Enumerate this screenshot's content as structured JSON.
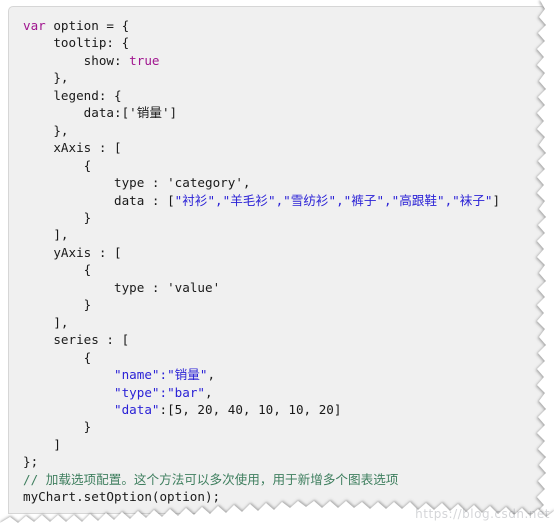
{
  "editor": {
    "language": "javascript",
    "background_color": "#f0f0f0",
    "border_color": "#d6d6d6",
    "colors": {
      "keyword": "#a0158f",
      "boolean": "#a0158f",
      "double_quoted_string": "#2b22d6",
      "single_quoted_string": "#1a1a1a",
      "comment": "#3f7f5f",
      "plain_text": "#1a1a1a"
    },
    "lines": [
      {
        "indent": 0,
        "tokens": [
          {
            "t": "var",
            "c": "kw"
          },
          {
            "t": " option = {",
            "c": "plain"
          }
        ]
      },
      {
        "indent": 1,
        "tokens": [
          {
            "t": "tooltip: {",
            "c": "plain"
          }
        ]
      },
      {
        "indent": 2,
        "tokens": [
          {
            "t": "show: ",
            "c": "plain"
          },
          {
            "t": "true",
            "c": "bool"
          }
        ]
      },
      {
        "indent": 1,
        "tokens": [
          {
            "t": "},",
            "c": "plain"
          }
        ]
      },
      {
        "indent": 1,
        "tokens": [
          {
            "t": "legend: {",
            "c": "plain"
          }
        ]
      },
      {
        "indent": 2,
        "tokens": [
          {
            "t": "data:['",
            "c": "plain"
          },
          {
            "t": "销量",
            "c": "str cjk"
          },
          {
            "t": "']",
            "c": "plain"
          }
        ]
      },
      {
        "indent": 1,
        "tokens": [
          {
            "t": "},",
            "c": "plain"
          }
        ]
      },
      {
        "indent": 1,
        "tokens": [
          {
            "t": "xAxis : [",
            "c": "plain"
          }
        ]
      },
      {
        "indent": 2,
        "tokens": [
          {
            "t": "{",
            "c": "plain"
          }
        ]
      },
      {
        "indent": 3,
        "tokens": [
          {
            "t": "type : 'category',",
            "c": "plain"
          }
        ]
      },
      {
        "indent": 3,
        "tokens": [
          {
            "t": "data : [",
            "c": "plain"
          },
          {
            "t": "\"",
            "c": "dstr"
          },
          {
            "t": "衬衫",
            "c": "dstr cjk"
          },
          {
            "t": "\",\"",
            "c": "dstr"
          },
          {
            "t": "羊毛衫",
            "c": "dstr cjk"
          },
          {
            "t": "\",\"",
            "c": "dstr"
          },
          {
            "t": "雪纺衫",
            "c": "dstr cjk"
          },
          {
            "t": "\",\"",
            "c": "dstr"
          },
          {
            "t": "裤子",
            "c": "dstr cjk"
          },
          {
            "t": "\",\"",
            "c": "dstr"
          },
          {
            "t": "高跟鞋",
            "c": "dstr cjk"
          },
          {
            "t": "\",\"",
            "c": "dstr"
          },
          {
            "t": "袜子",
            "c": "dstr cjk"
          },
          {
            "t": "\"",
            "c": "dstr"
          },
          {
            "t": "]",
            "c": "plain"
          }
        ]
      },
      {
        "indent": 2,
        "tokens": [
          {
            "t": "}",
            "c": "plain"
          }
        ]
      },
      {
        "indent": 1,
        "tokens": [
          {
            "t": "],",
            "c": "plain"
          }
        ]
      },
      {
        "indent": 1,
        "tokens": [
          {
            "t": "yAxis : [",
            "c": "plain"
          }
        ]
      },
      {
        "indent": 2,
        "tokens": [
          {
            "t": "{",
            "c": "plain"
          }
        ]
      },
      {
        "indent": 3,
        "tokens": [
          {
            "t": "type : 'value'",
            "c": "plain"
          }
        ]
      },
      {
        "indent": 2,
        "tokens": [
          {
            "t": "}",
            "c": "plain"
          }
        ]
      },
      {
        "indent": 1,
        "tokens": [
          {
            "t": "],",
            "c": "plain"
          }
        ]
      },
      {
        "indent": 1,
        "tokens": [
          {
            "t": "series : [",
            "c": "plain"
          }
        ]
      },
      {
        "indent": 2,
        "tokens": [
          {
            "t": "{",
            "c": "plain"
          }
        ]
      },
      {
        "indent": 3,
        "tokens": [
          {
            "t": "\"name\":\"",
            "c": "dstr"
          },
          {
            "t": "销量",
            "c": "dstr cjk"
          },
          {
            "t": "\"",
            "c": "dstr"
          },
          {
            "t": ",",
            "c": "plain"
          }
        ]
      },
      {
        "indent": 3,
        "tokens": [
          {
            "t": "\"type\":\"bar\"",
            "c": "dstr"
          },
          {
            "t": ",",
            "c": "plain"
          }
        ]
      },
      {
        "indent": 3,
        "tokens": [
          {
            "t": "\"data\"",
            "c": "dstr"
          },
          {
            "t": ":[5, 20, 40, 10, 10, 20]",
            "c": "plain"
          }
        ]
      },
      {
        "indent": 2,
        "tokens": [
          {
            "t": "}",
            "c": "plain"
          }
        ]
      },
      {
        "indent": 1,
        "tokens": [
          {
            "t": "]",
            "c": "plain"
          }
        ]
      },
      {
        "indent": 0,
        "tokens": [
          {
            "t": "};",
            "c": "plain"
          }
        ]
      },
      {
        "indent": 0,
        "tokens": [
          {
            "t": "// ",
            "c": "comment"
          },
          {
            "t": "加载选项配置。这个方法可以多次使用，用于新增多个图表选项",
            "c": "comment cjk"
          }
        ]
      },
      {
        "indent": 0,
        "tokens": [
          {
            "t": "myChart.setOption(option);",
            "c": "plain"
          }
        ]
      }
    ]
  },
  "watermark": {
    "text": "https://blog.csdn.net"
  },
  "code_content": {
    "option_object": {
      "tooltip": {
        "show": true
      },
      "legend": {
        "data": [
          "销量"
        ]
      },
      "xAxis": [
        {
          "type": "category",
          "data": [
            "衬衫",
            "羊毛衫",
            "雪纺衫",
            "裤子",
            "高跟鞋",
            "袜子"
          ]
        }
      ],
      "yAxis": [
        {
          "type": "value"
        }
      ],
      "series": [
        {
          "name": "销量",
          "type": "bar",
          "data": [
            5,
            20,
            40,
            10,
            10,
            20
          ]
        }
      ]
    },
    "trailing_comment": "// 加载选项配置。这个方法可以多次使用，用于新增多个图表选项",
    "trailing_statement": "myChart.setOption(option);"
  }
}
